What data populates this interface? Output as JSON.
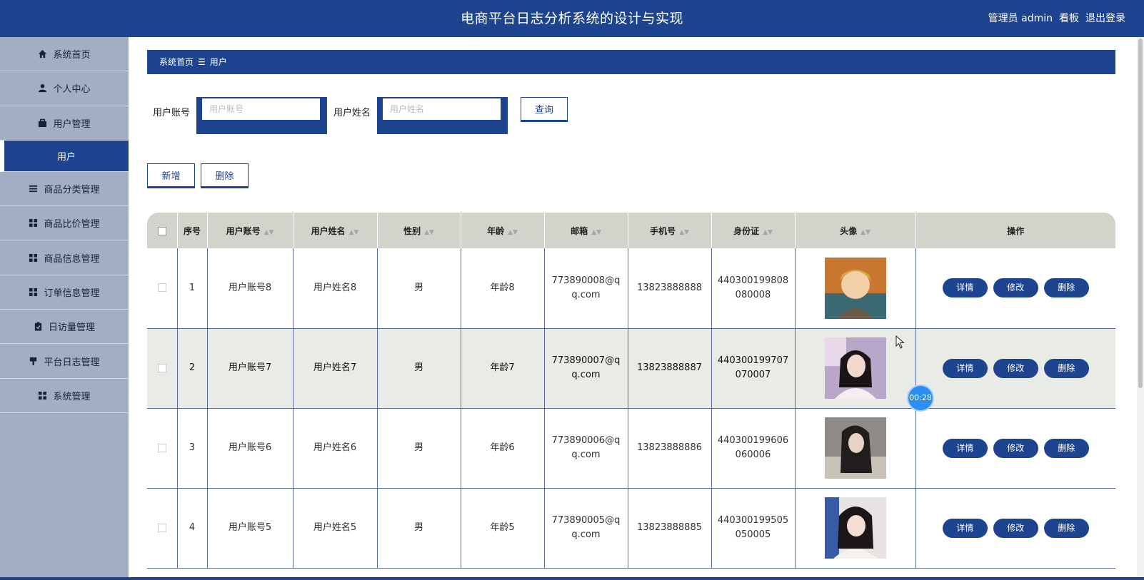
{
  "header": {
    "title": "电商平台日志分析系统的设计与实现",
    "admin_label": "管理员 admin",
    "board_label": "看板",
    "logout_label": "退出登录"
  },
  "sidebar": {
    "items": [
      {
        "label": "系统首页",
        "icon": "home-icon"
      },
      {
        "label": "个人中心",
        "icon": "user-icon"
      },
      {
        "label": "用户管理",
        "icon": "briefcase-icon"
      },
      {
        "label": "用户",
        "icon": ""
      },
      {
        "label": "商品分类管理",
        "icon": "list-icon"
      },
      {
        "label": "商品比价管理",
        "icon": "grid-icon"
      },
      {
        "label": "商品信息管理",
        "icon": "grid-icon"
      },
      {
        "label": "订单信息管理",
        "icon": "grid-icon"
      },
      {
        "label": "日访量管理",
        "icon": "clipboard-icon"
      },
      {
        "label": "平台日志管理",
        "icon": "pin-icon"
      },
      {
        "label": "系统管理",
        "icon": "grid-icon"
      }
    ]
  },
  "breadcrumb": {
    "home": "系统首页",
    "sep": "☰",
    "current": "用户"
  },
  "search": {
    "account_label": "用户账号",
    "account_placeholder": "用户账号",
    "name_label": "用户姓名",
    "name_placeholder": "用户姓名",
    "query_label": "查询"
  },
  "actions": {
    "add_label": "新增",
    "delete_label": "删除"
  },
  "table": {
    "headers": [
      "序号",
      "用户账号",
      "用户姓名",
      "性别",
      "年龄",
      "邮箱",
      "手机号",
      "身份证",
      "头像",
      "操作"
    ],
    "rows": [
      {
        "no": "1",
        "account": "用户账号8",
        "name": "用户姓名8",
        "gender": "男",
        "age": "年龄8",
        "email": "773890008@qq.com",
        "phone": "13823888888",
        "id_card": "440300199808080008"
      },
      {
        "no": "2",
        "account": "用户账号7",
        "name": "用户姓名7",
        "gender": "男",
        "age": "年龄7",
        "email": "773890007@qq.com",
        "phone": "13823888887",
        "id_card": "440300199707070007"
      },
      {
        "no": "3",
        "account": "用户账号6",
        "name": "用户姓名6",
        "gender": "男",
        "age": "年龄6",
        "email": "773890006@qq.com",
        "phone": "13823888886",
        "id_card": "440300199606060006"
      },
      {
        "no": "4",
        "account": "用户账号5",
        "name": "用户姓名5",
        "gender": "男",
        "age": "年龄5",
        "email": "773890005@qq.com",
        "phone": "13823888885",
        "id_card": "440300199505050005"
      }
    ],
    "op_labels": {
      "detail": "详情",
      "edit": "修改",
      "delete": "删除"
    }
  },
  "timer": "00:28",
  "colors": {
    "primary": "#1f448f",
    "sidebar": "#a2aec3",
    "header_row": "#d3d3cc"
  }
}
